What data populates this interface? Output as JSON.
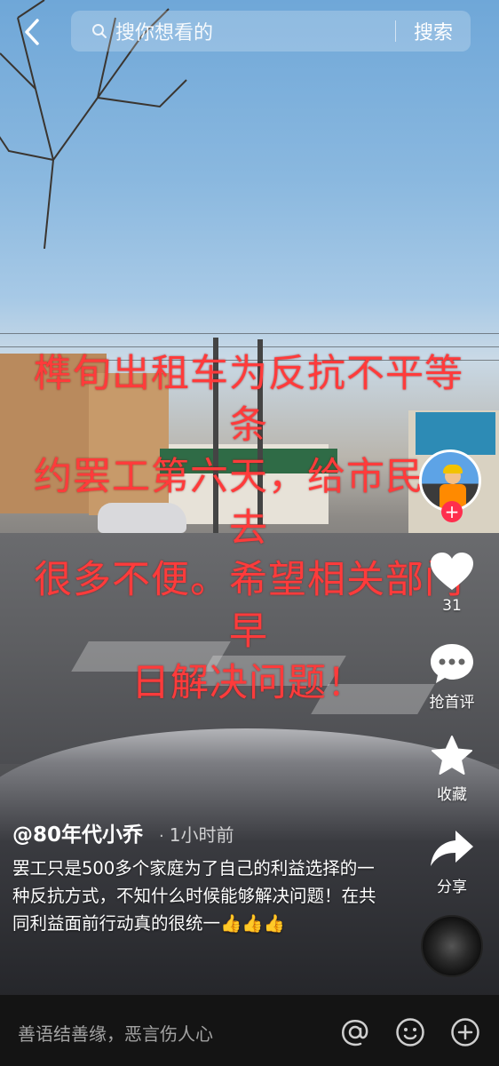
{
  "search": {
    "placeholder": "搜你想看的",
    "button_label": "搜索"
  },
  "video": {
    "overlay_caption_lines": [
      "榫旬出租车为反抗不平等条",
      "约罢工第六天，给市民带去",
      "很多不便。希望相关部门早",
      "日解决问题！"
    ]
  },
  "actions": {
    "like_count": "31",
    "comment_label": "抢首评",
    "favorite_label": "收藏",
    "share_label": "分享",
    "follow_symbol": "+"
  },
  "post": {
    "author": "@80年代小乔",
    "separator": "·",
    "time_ago": "1小时前",
    "description": "罢工只是500多个家庭为了自己的利益选择的一种反抗方式，不知什么时候能够解决问题！在共同利益面前行动真的很统一👍👍👍"
  },
  "comment_bar": {
    "placeholder": "善语结善缘，恶言伤人心",
    "at_symbol": "@"
  },
  "colors": {
    "overlay_text": "#ff3b3b",
    "follow_badge": "#ff2e4d",
    "bottom_bar": "#141414"
  },
  "icons": [
    "back-arrow-icon",
    "search-icon",
    "heart-icon",
    "comment-icon",
    "star-icon",
    "share-icon",
    "at-icon",
    "emoji-icon",
    "plus-icon"
  ]
}
